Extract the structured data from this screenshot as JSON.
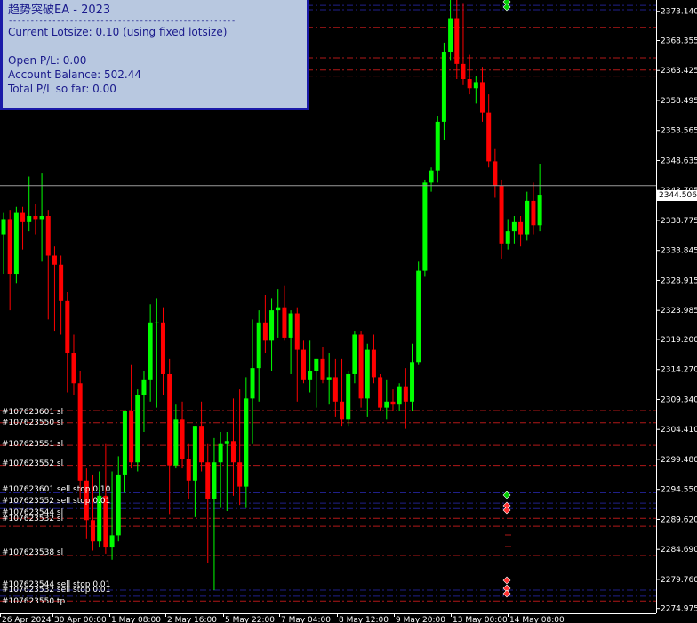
{
  "panel": {
    "title": "趋势突破EA  - 2023",
    "separator": "----------------------------------------------------",
    "lotsize": "Current Lotsize: 0.10 (using fixed lotsize)",
    "open_pl": "Open P/L: 0.00",
    "balance": "Account Balance: 502.44",
    "total_pl": "Total P/L so far: 0.00"
  },
  "current_price": "2344.506",
  "colors": {
    "background": "#000000",
    "bull_candle": "#00ff00",
    "bear_candle": "#ff0000",
    "text": "#ffffff",
    "order_line": "#b01818",
    "pending_line": "#20208a",
    "panel_bg": "#b8c8e0",
    "panel_border": "#1a1aa8",
    "panel_text": "#1a1a8c"
  },
  "order_labels": [
    "#107623601 sl",
    "#107623550 sl",
    "#107623551 sl",
    "#107623552 sl",
    "#107623601 sell stop 0.10",
    "#107623552 sell stop 0.01",
    "#107623544 sl",
    "#107623532 sl",
    "#107623538 sl",
    "#107623544 sell stop 0.01",
    "#107623532 sell stop 0.01",
    "#107623550 tp"
  ],
  "chart_data": {
    "type": "candlestick",
    "symbol_timeframe": "",
    "y_ticks": [
      "2373.140",
      "2368.355",
      "2363.425",
      "2358.495",
      "2353.565",
      "2348.635",
      "2343.705",
      "2338.775",
      "2333.845",
      "2328.915",
      "2323.985",
      "2319.200",
      "2314.270",
      "2309.340",
      "2304.410",
      "2299.480",
      "2294.550",
      "2289.620",
      "2284.690",
      "2279.760",
      "2274.975"
    ],
    "x_ticks": [
      "26 Apr 2024",
      "30 Apr 00:00",
      "1 May 08:00",
      "2 May 16:00",
      "5 May 22:00",
      "7 May 04:00",
      "8 May 12:00",
      "9 May 20:00",
      "13 May 00:00",
      "14 May 08:00"
    ],
    "ylim": [
      2274.2,
      2375.0
    ],
    "candles": [
      {
        "o": 2336.5,
        "h": 2340.0,
        "l": 2330.0,
        "c": 2339.0
      },
      {
        "o": 2339.0,
        "h": 2340.5,
        "l": 2324.0,
        "c": 2330.0
      },
      {
        "o": 2330.0,
        "h": 2341.0,
        "l": 2328.5,
        "c": 2340.0
      },
      {
        "o": 2340.0,
        "h": 2341.0,
        "l": 2334.0,
        "c": 2338.5
      },
      {
        "o": 2338.5,
        "h": 2346.0,
        "l": 2337.0,
        "c": 2339.5
      },
      {
        "o": 2339.5,
        "h": 2341.5,
        "l": 2336.5,
        "c": 2339.0
      },
      {
        "o": 2339.0,
        "h": 2346.5,
        "l": 2332.0,
        "c": 2339.5
      },
      {
        "o": 2339.5,
        "h": 2340.5,
        "l": 2322.5,
        "c": 2333.0
      },
      {
        "o": 2333.0,
        "h": 2334.5,
        "l": 2320.5,
        "c": 2331.5
      },
      {
        "o": 2331.5,
        "h": 2333.0,
        "l": 2320.0,
        "c": 2325.5
      },
      {
        "o": 2325.5,
        "h": 2327.0,
        "l": 2310.5,
        "c": 2317.0
      },
      {
        "o": 2317.0,
        "h": 2320.0,
        "l": 2310.0,
        "c": 2312.0
      },
      {
        "o": 2312.0,
        "h": 2314.0,
        "l": 2293.0,
        "c": 2296.0
      },
      {
        "o": 2296.0,
        "h": 2298.0,
        "l": 2286.5,
        "c": 2289.5
      },
      {
        "o": 2289.5,
        "h": 2297.0,
        "l": 2284.5,
        "c": 2286.0
      },
      {
        "o": 2286.0,
        "h": 2297.5,
        "l": 2285.0,
        "c": 2293.5
      },
      {
        "o": 2293.5,
        "h": 2302.0,
        "l": 2284.0,
        "c": 2285.0
      },
      {
        "o": 2285.0,
        "h": 2297.5,
        "l": 2283.0,
        "c": 2287.0
      },
      {
        "o": 2287.0,
        "h": 2300.0,
        "l": 2286.0,
        "c": 2297.0
      },
      {
        "o": 2297.0,
        "h": 2303.0,
        "l": 2294.0,
        "c": 2307.5
      },
      {
        "o": 2307.5,
        "h": 2315.0,
        "l": 2298.0,
        "c": 2299.0
      },
      {
        "o": 2299.0,
        "h": 2311.0,
        "l": 2297.5,
        "c": 2310.0
      },
      {
        "o": 2310.0,
        "h": 2314.0,
        "l": 2304.0,
        "c": 2312.5
      },
      {
        "o": 2312.5,
        "h": 2325.0,
        "l": 2309.0,
        "c": 2322.0
      },
      {
        "o": 2322.0,
        "h": 2326.0,
        "l": 2308.0,
        "c": 2322.0
      },
      {
        "o": 2322.0,
        "h": 2324.5,
        "l": 2310.0,
        "c": 2313.5
      },
      {
        "o": 2313.5,
        "h": 2316.0,
        "l": 2290.5,
        "c": 2298.5
      },
      {
        "o": 2298.5,
        "h": 2308.5,
        "l": 2298.0,
        "c": 2306.0
      },
      {
        "o": 2306.0,
        "h": 2309.0,
        "l": 2298.0,
        "c": 2299.5
      },
      {
        "o": 2299.5,
        "h": 2302.0,
        "l": 2293.0,
        "c": 2296.0
      },
      {
        "o": 2296.0,
        "h": 2305.0,
        "l": 2290.0,
        "c": 2305.0
      },
      {
        "o": 2305.0,
        "h": 2309.0,
        "l": 2297.5,
        "c": 2299.0
      },
      {
        "o": 2299.0,
        "h": 2302.0,
        "l": 2282.5,
        "c": 2293.0
      },
      {
        "o": 2293.0,
        "h": 2303.0,
        "l": 2278.0,
        "c": 2299.0
      },
      {
        "o": 2299.0,
        "h": 2304.0,
        "l": 2291.5,
        "c": 2302.0
      },
      {
        "o": 2302.0,
        "h": 2304.0,
        "l": 2291.0,
        "c": 2302.5
      },
      {
        "o": 2302.5,
        "h": 2309.5,
        "l": 2293.5,
        "c": 2299.0
      },
      {
        "o": 2299.0,
        "h": 2311.0,
        "l": 2292.0,
        "c": 2295.0
      },
      {
        "o": 2295.0,
        "h": 2313.0,
        "l": 2291.5,
        "c": 2309.5
      },
      {
        "o": 2309.5,
        "h": 2322.5,
        "l": 2302.0,
        "c": 2314.5
      },
      {
        "o": 2314.5,
        "h": 2324.0,
        "l": 2309.0,
        "c": 2322.0
      },
      {
        "o": 2322.0,
        "h": 2326.5,
        "l": 2317.0,
        "c": 2319.0
      },
      {
        "o": 2319.0,
        "h": 2326.0,
        "l": 2314.0,
        "c": 2324.0
      },
      {
        "o": 2324.0,
        "h": 2327.5,
        "l": 2319.5,
        "c": 2324.5
      },
      {
        "o": 2324.5,
        "h": 2328.0,
        "l": 2319.0,
        "c": 2319.5
      },
      {
        "o": 2319.5,
        "h": 2324.0,
        "l": 2313.5,
        "c": 2323.5
      },
      {
        "o": 2323.5,
        "h": 2324.5,
        "l": 2309.0,
        "c": 2317.5
      },
      {
        "o": 2317.5,
        "h": 2319.0,
        "l": 2312.0,
        "c": 2312.5
      },
      {
        "o": 2312.5,
        "h": 2319.0,
        "l": 2310.5,
        "c": 2314.0
      },
      {
        "o": 2314.0,
        "h": 2316.0,
        "l": 2308.0,
        "c": 2316.0
      },
      {
        "o": 2316.0,
        "h": 2318.0,
        "l": 2312.0,
        "c": 2312.5
      },
      {
        "o": 2312.5,
        "h": 2317.0,
        "l": 2308.5,
        "c": 2313.0
      },
      {
        "o": 2313.0,
        "h": 2316.0,
        "l": 2306.5,
        "c": 2309.0
      },
      {
        "o": 2309.0,
        "h": 2316.0,
        "l": 2305.0,
        "c": 2306.0
      },
      {
        "o": 2306.0,
        "h": 2314.0,
        "l": 2305.0,
        "c": 2313.5
      },
      {
        "o": 2313.5,
        "h": 2320.5,
        "l": 2312.0,
        "c": 2320.0
      },
      {
        "o": 2320.0,
        "h": 2320.5,
        "l": 2308.0,
        "c": 2309.5
      },
      {
        "o": 2309.5,
        "h": 2318.5,
        "l": 2306.5,
        "c": 2317.5
      },
      {
        "o": 2317.5,
        "h": 2320.0,
        "l": 2312.0,
        "c": 2313.0
      },
      {
        "o": 2313.0,
        "h": 2313.5,
        "l": 2307.5,
        "c": 2308.0
      },
      {
        "o": 2308.0,
        "h": 2312.5,
        "l": 2306.0,
        "c": 2309.0
      },
      {
        "o": 2309.0,
        "h": 2311.0,
        "l": 2307.5,
        "c": 2308.5
      },
      {
        "o": 2308.5,
        "h": 2312.0,
        "l": 2307.5,
        "c": 2311.5
      },
      {
        "o": 2311.5,
        "h": 2314.5,
        "l": 2304.5,
        "c": 2309.0
      },
      {
        "o": 2309.0,
        "h": 2318.5,
        "l": 2307.5,
        "c": 2315.5
      },
      {
        "o": 2315.5,
        "h": 2332.0,
        "l": 2315.0,
        "c": 2330.5
      },
      {
        "o": 2330.5,
        "h": 2345.5,
        "l": 2329.5,
        "c": 2345.0
      },
      {
        "o": 2345.0,
        "h": 2347.5,
        "l": 2343.5,
        "c": 2347.0
      },
      {
        "o": 2347.0,
        "h": 2356.0,
        "l": 2345.0,
        "c": 2355.0
      },
      {
        "o": 2355.0,
        "h": 2368.0,
        "l": 2352.0,
        "c": 2366.5
      },
      {
        "o": 2366.5,
        "h": 2377.0,
        "l": 2365.0,
        "c": 2372.0
      },
      {
        "o": 2372.0,
        "h": 2375.5,
        "l": 2362.0,
        "c": 2364.5
      },
      {
        "o": 2364.5,
        "h": 2374.5,
        "l": 2361.0,
        "c": 2362.0
      },
      {
        "o": 2362.0,
        "h": 2366.0,
        "l": 2359.5,
        "c": 2360.5
      },
      {
        "o": 2360.5,
        "h": 2362.5,
        "l": 2358.0,
        "c": 2361.5
      },
      {
        "o": 2361.5,
        "h": 2364.0,
        "l": 2355.0,
        "c": 2356.5
      },
      {
        "o": 2356.5,
        "h": 2359.5,
        "l": 2347.5,
        "c": 2348.5
      },
      {
        "o": 2348.5,
        "h": 2350.5,
        "l": 2342.5,
        "c": 2344.5
      },
      {
        "o": 2344.5,
        "h": 2345.5,
        "l": 2332.5,
        "c": 2335.0
      },
      {
        "o": 2335.0,
        "h": 2339.0,
        "l": 2334.0,
        "c": 2337.0
      },
      {
        "o": 2337.0,
        "h": 2339.5,
        "l": 2335.0,
        "c": 2338.5
      },
      {
        "o": 2338.5,
        "h": 2339.5,
        "l": 2334.5,
        "c": 2336.5
      },
      {
        "o": 2336.5,
        "h": 2343.5,
        "l": 2335.5,
        "c": 2342.0
      },
      {
        "o": 2342.0,
        "h": 2345.0,
        "l": 2336.5,
        "c": 2338.0
      },
      {
        "o": 2338.0,
        "h": 2348.0,
        "l": 2337.0,
        "c": 2343.0
      }
    ],
    "bid_line": 2344.506,
    "order_lines": [
      {
        "price": 2374.1,
        "style": "pending"
      },
      {
        "price": 2373.4,
        "style": "pending"
      },
      {
        "price": 2370.5,
        "style": "order"
      },
      {
        "price": 2365.5,
        "style": "order"
      },
      {
        "price": 2363.5,
        "style": "order"
      },
      {
        "price": 2362.5,
        "style": "order"
      },
      {
        "price": 2307.5,
        "style": "order"
      },
      {
        "price": 2305.5,
        "style": "order"
      },
      {
        "price": 2301.8,
        "style": "order"
      },
      {
        "price": 2298.5,
        "style": "order"
      },
      {
        "price": 2294.0,
        "style": "pending"
      },
      {
        "price": 2292.3,
        "style": "pending"
      },
      {
        "price": 2291.4,
        "style": "pending"
      },
      {
        "price": 2289.8,
        "style": "order"
      },
      {
        "price": 2288.5,
        "style": "order"
      },
      {
        "price": 2283.7,
        "style": "order"
      },
      {
        "price": 2278.0,
        "style": "pending"
      },
      {
        "price": 2277.0,
        "style": "pending"
      },
      {
        "price": 2276.2,
        "style": "order"
      }
    ]
  }
}
